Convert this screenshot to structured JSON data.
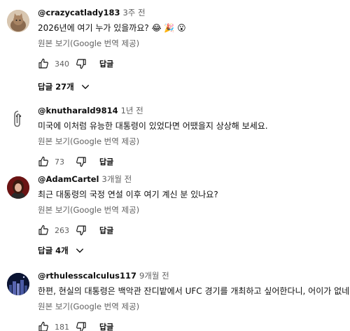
{
  "comments": [
    {
      "author": "@crazycatlady183",
      "time": "3주 전",
      "text": "2026년에 여기 누가 있을까요? 😂 🎉 😮",
      "translate_label": "원본 보기(Google 번역 제공)",
      "likes": "340",
      "reply_label": "답글",
      "replies_label": "답글 27개",
      "avatar_icon": "cat-avatar"
    },
    {
      "author": "@knutharald9814",
      "time": "1년 전",
      "text": "미국에 이처럼 유능한 대통령이 있었다면 어땠을지 상상해 보세요.",
      "translate_label": "원본 보기(Google 번역 제공)",
      "likes": "73",
      "reply_label": "답글",
      "avatar_icon": "paperclip-avatar"
    },
    {
      "author": "@AdamCartel",
      "time": "3개월 전",
      "text": "최근 대통령의 국정 연설 이후 여기 계신 분 있나요?",
      "translate_label": "원본 보기(Google 번역 제공)",
      "likes": "263",
      "reply_label": "답글",
      "replies_label": "답글 4개",
      "avatar_icon": "portrait-avatar"
    },
    {
      "author": "@rthulesscalculus117",
      "time": "9개월 전",
      "text": "한편, 현실의 대통령은 백악관 잔디밭에서 UFC 경기를 개최하고 싶어한다니, 어이가 없네.",
      "translate_label": "원본 보기(Google 번역 제공)",
      "likes": "181",
      "reply_label": "답글",
      "avatar_icon": "night-city-avatar"
    }
  ],
  "colors": {
    "text": "#0f0f0f",
    "secondary": "#606060"
  }
}
